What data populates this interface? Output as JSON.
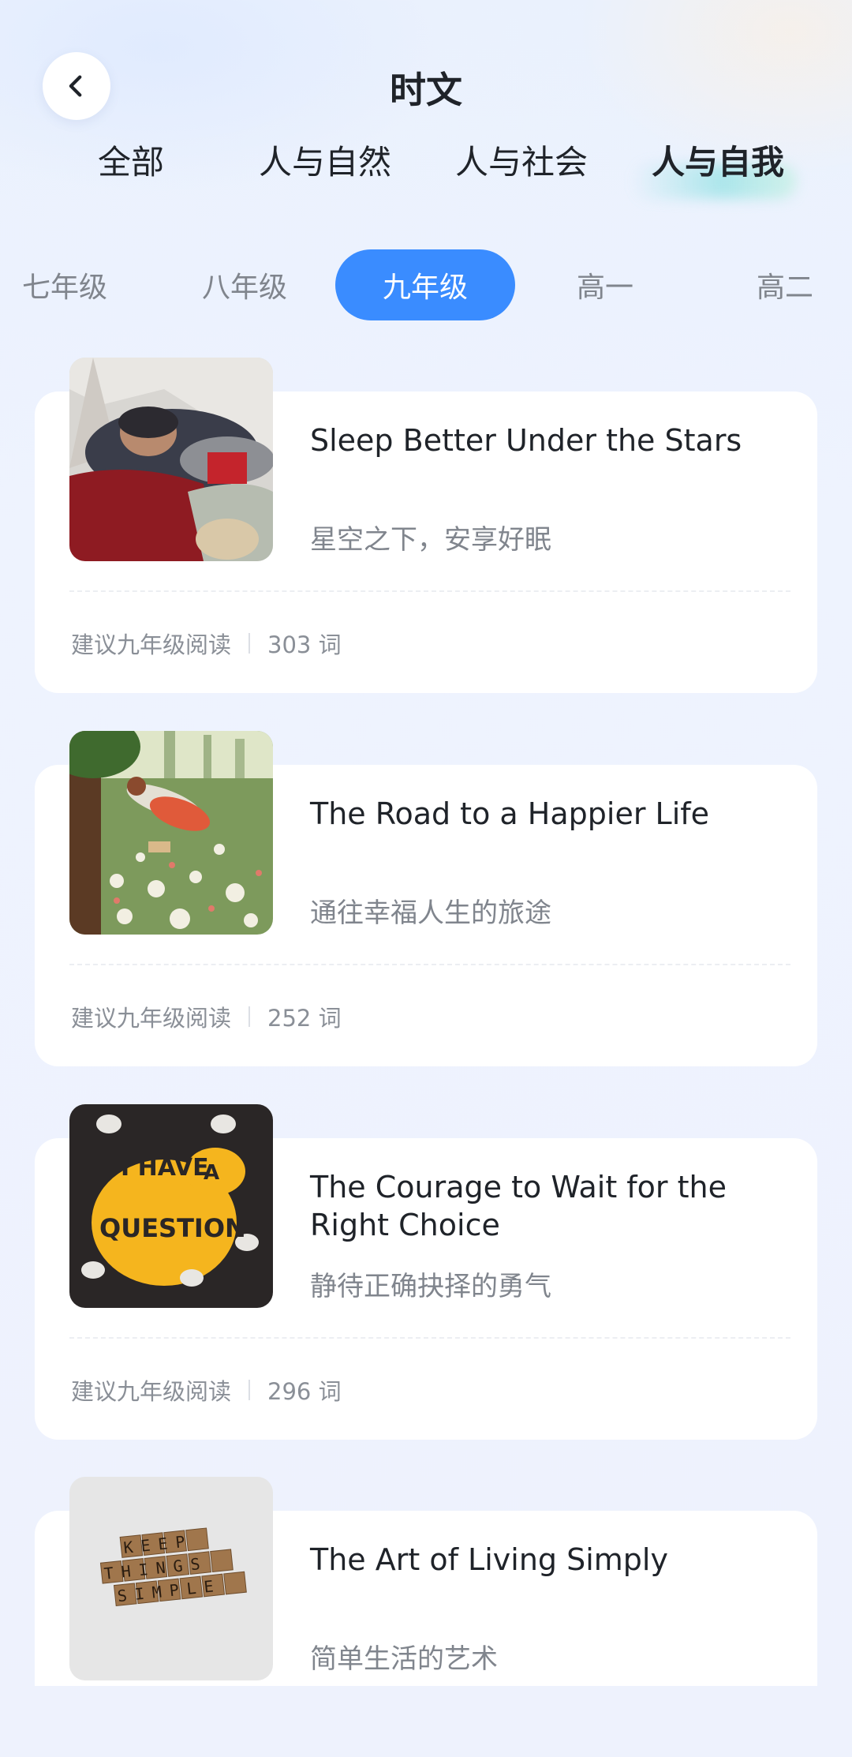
{
  "header": {
    "title": "时文",
    "back_icon": "chevron-left-icon"
  },
  "topic_tabs": [
    {
      "label": "全部",
      "active": false
    },
    {
      "label": "人与自然",
      "active": false
    },
    {
      "label": "人与社会",
      "active": false
    },
    {
      "label": "人与自我",
      "active": true
    }
  ],
  "grade_tabs": [
    {
      "label": "七年级",
      "active": false
    },
    {
      "label": "八年级",
      "active": false
    },
    {
      "label": "九年级",
      "active": true
    },
    {
      "label": "高一",
      "active": false
    },
    {
      "label": "高二",
      "active": false
    }
  ],
  "articles": [
    {
      "title": "Sleep Better Under the Stars",
      "subtitle": "星空之下，安享好眠",
      "grade_note": "建议九年级阅读",
      "words": "303 词",
      "thumb": "sleeping-camper-image"
    },
    {
      "title": "The Road to a Happier Life",
      "subtitle": "通往幸福人生的旅途",
      "grade_note": "建议九年级阅读",
      "words": "252 词",
      "thumb": "girl-in-meadow-image"
    },
    {
      "title": "The Courage to Wait for the Right Choice",
      "subtitle": "静待正确抉择的勇气",
      "grade_note": "建议九年级阅读",
      "words": "296 词",
      "thumb": "i-have-a-question-image",
      "thumb_text": [
        "I HAVE",
        "A",
        "QUESTION"
      ]
    },
    {
      "title": "The Art of Living Simply",
      "subtitle": "简单生活的艺术",
      "grade_note": "",
      "words": "",
      "thumb": "scrabble-tiles-image",
      "thumb_text": [
        "KEEP",
        "THINGS",
        "SIMPLE"
      ]
    }
  ],
  "colors": {
    "accent": "#3a8cff",
    "text_primary": "#1f2329",
    "text_secondary": "#80858d",
    "card_bg": "#ffffff"
  }
}
